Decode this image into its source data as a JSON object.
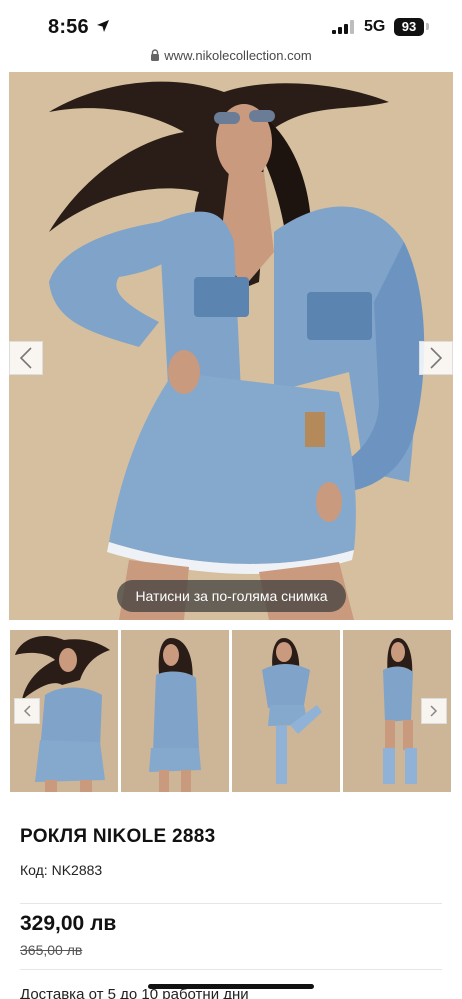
{
  "status_bar": {
    "time": "8:56",
    "network": "5G",
    "battery": "93"
  },
  "browser": {
    "url": "www.nikolecollection.com"
  },
  "gallery": {
    "caption": "Натисни за по-голяма снимка",
    "thumbnail_count": 4,
    "colors": {
      "background": "#d5bf9f",
      "denim": "#7fa3c9",
      "denim_dark": "#5b84b1",
      "hair": "#2a1d17",
      "skin": "#c99a7e"
    }
  },
  "product": {
    "title": "РОКЛЯ NIKOLE 2883",
    "code": "Код: NK2883",
    "price": "329,00 лв",
    "old_price": "365,00 лв",
    "delivery": "Доставка от 5 до 10 работни дни"
  },
  "icons": [
    "location-arrow-icon",
    "signal-icon",
    "lock-icon",
    "chevron-left-icon",
    "chevron-right-icon"
  ]
}
